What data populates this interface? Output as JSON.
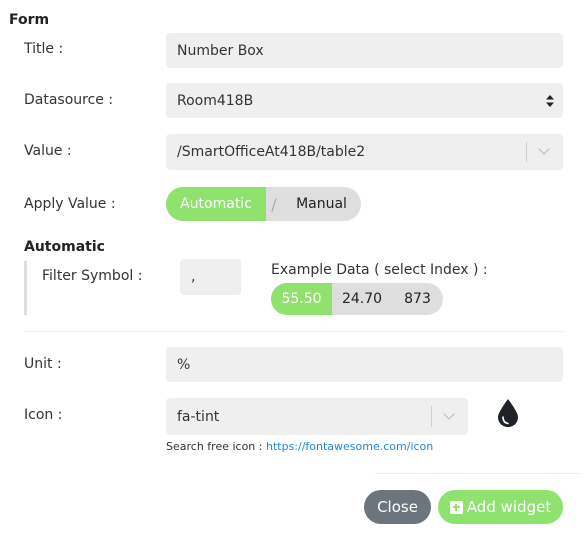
{
  "form": {
    "title": "Form",
    "title_label": "Title :",
    "title_value": "Number Box",
    "datasource_label": "Datasource :",
    "datasource_value": "Room418B",
    "value_label": "Value :",
    "value_value": "/SmartOfficeAt418B/table2",
    "apply_value_label": "Apply Value :",
    "apply_options": {
      "automatic": "Automatic",
      "separator": "/",
      "manual": "Manual",
      "selected": "Automatic"
    }
  },
  "automatic": {
    "heading": "Automatic",
    "filter_symbol_label": "Filter Symbol :",
    "filter_symbol_value": ",",
    "example_label": "Example Data ( select Index ) :",
    "example_values": [
      "55.50",
      "24.70",
      "873"
    ],
    "selected_index": 0
  },
  "unit": {
    "label": "Unit :",
    "value": "%"
  },
  "icon": {
    "label": "Icon :",
    "value": "fa-tint",
    "preview_icon": "tint-icon",
    "search_text": "Search free icon : ",
    "search_link": "https://fontawesome.com/icon"
  },
  "footer": {
    "close_label": "Close",
    "add_label": "Add widget"
  },
  "colors": {
    "accent": "#90e26e",
    "close": "#6c757d",
    "field_bg": "#efefef",
    "link": "#1e88e5"
  }
}
